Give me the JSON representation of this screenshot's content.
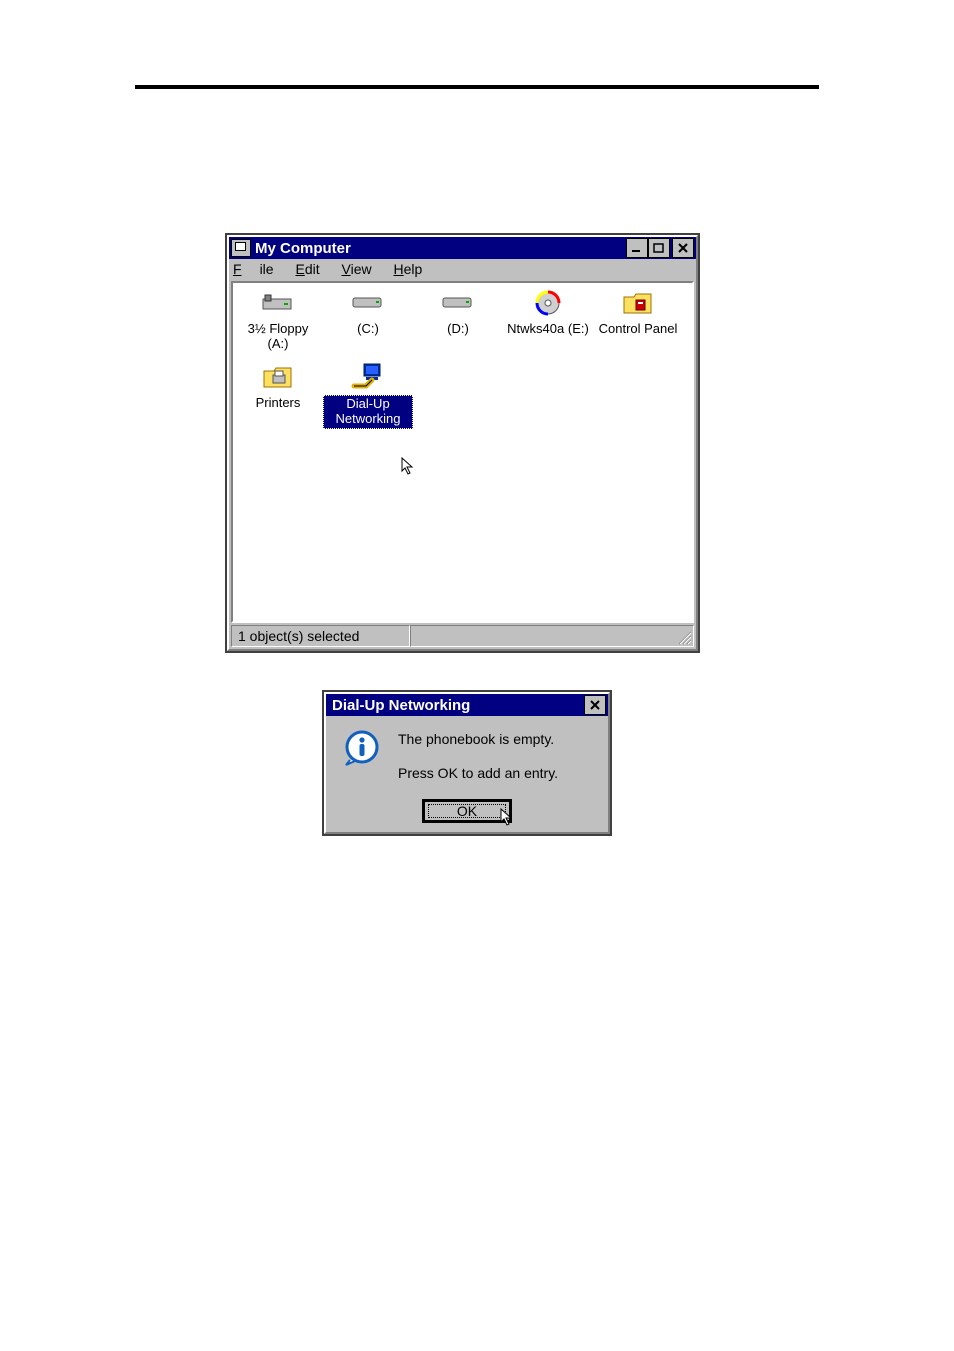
{
  "window1": {
    "title": "My Computer",
    "menus": {
      "file": "File",
      "edit": "Edit",
      "view": "View",
      "help": "Help"
    },
    "items": [
      {
        "label": "3½ Floppy (A:)",
        "icon": "floppy-drive-icon",
        "selected": false
      },
      {
        "label": "(C:)",
        "icon": "hard-drive-icon",
        "selected": false
      },
      {
        "label": "(D:)",
        "icon": "hard-drive-icon",
        "selected": false
      },
      {
        "label": "Ntwks40a (E:)",
        "icon": "cd-drive-icon",
        "selected": false
      },
      {
        "label": "Control Panel",
        "icon": "control-panel-folder-icon",
        "selected": false
      },
      {
        "label": "Printers",
        "icon": "printers-folder-icon",
        "selected": false
      },
      {
        "label": "Dial-Up Networking",
        "icon": "dial-up-networking-icon",
        "selected": true
      }
    ],
    "statusbar": "1 object(s) selected"
  },
  "dialog": {
    "title": "Dial-Up Networking",
    "line1": "The phonebook is empty.",
    "line2": "Press OK to add an entry.",
    "ok": "OK"
  }
}
